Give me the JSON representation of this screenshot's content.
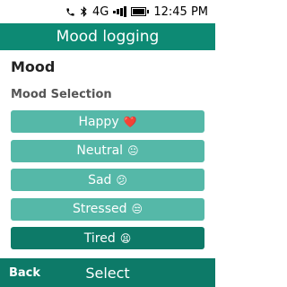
{
  "status_bar": {
    "network": "4G",
    "time": "12:45 PM",
    "icons": [
      "phone-icon",
      "bluetooth-icon",
      "signal-icon",
      "battery-icon"
    ]
  },
  "header": {
    "title": "Mood logging"
  },
  "section": {
    "title": "Mood",
    "subtitle": "Mood Selection"
  },
  "moods": [
    {
      "label": "Happy",
      "emoji": "❤️",
      "selected": false
    },
    {
      "label": "Neutral",
      "emoji": "😐",
      "selected": false
    },
    {
      "label": "Sad",
      "emoji": "😕",
      "selected": false
    },
    {
      "label": "Stressed",
      "emoji": "😒",
      "selected": false
    },
    {
      "label": "Tired",
      "emoji": "😫",
      "selected": true
    }
  ],
  "softkeys": {
    "left": "Back",
    "center": "Select"
  },
  "colors": {
    "header": "#0d8a74",
    "button": "#55b8a8",
    "button_selected": "#0d7a68",
    "softkey_bar": "#0d7a68"
  }
}
